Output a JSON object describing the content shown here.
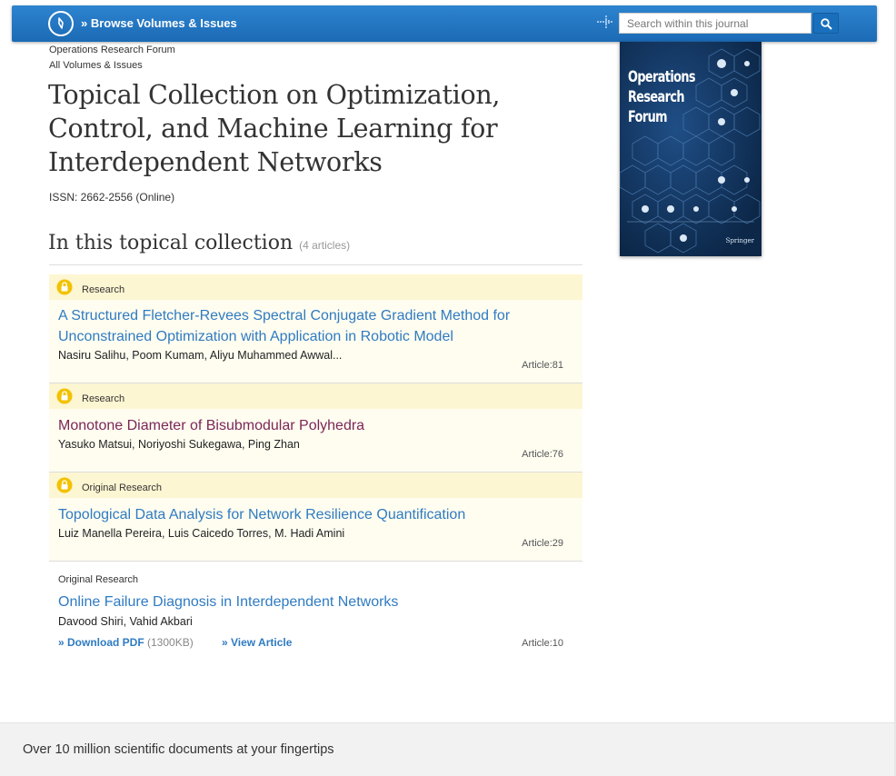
{
  "topbar": {
    "browse_label": "» Browse Volumes & Issues",
    "search_placeholder": "Search within this journal"
  },
  "header": {
    "journal_name": "Operations Research Forum",
    "breadcrumb_all": "All Volumes & Issues",
    "title": "Topical Collection on Optimization, Control, and Machine Learning for Interdependent Networks",
    "issn": "ISSN: 2662-2556 (Online)"
  },
  "collection": {
    "heading": "In this topical collection",
    "count": "(4 articles)"
  },
  "cover": {
    "title": "Operations Research Forum",
    "publisher": "Springer"
  },
  "articles": [
    {
      "type": "Research",
      "title": "A Structured Fletcher-Revees Spectral Conjugate Gradient Method for Unconstrained Optimization with Application in Robotic Model",
      "authors": "Nasiru Salihu, Poom Kumam, Aliyu Muhammed Awwal...",
      "number": "Article:81",
      "locked": true
    },
    {
      "type": "Research",
      "title": "Monotone Diameter of Bisubmodular Polyhedra",
      "authors": "Yasuko Matsui, Noriyoshi Sukegawa, Ping Zhan",
      "number": "Article:76",
      "locked": true
    },
    {
      "type": "Original Research",
      "title": "Topological Data Analysis for Network Resilience Quantification",
      "authors": "Luiz Manella Pereira, Luis Caicedo Torres, M. Hadi Amini",
      "number": "Article:29",
      "locked": true
    },
    {
      "type": "Original Research",
      "title": "Online Failure Diagnosis in Interdependent Networks",
      "authors": "Davood Shiri, Vahid Akbari",
      "number": "Article:10",
      "locked": false,
      "pdf_label": "» Download PDF",
      "pdf_size": "(1300KB)",
      "view_label": "» View Article"
    }
  ],
  "footer": {
    "text": "Over 10 million scientific documents at your fingertips"
  }
}
